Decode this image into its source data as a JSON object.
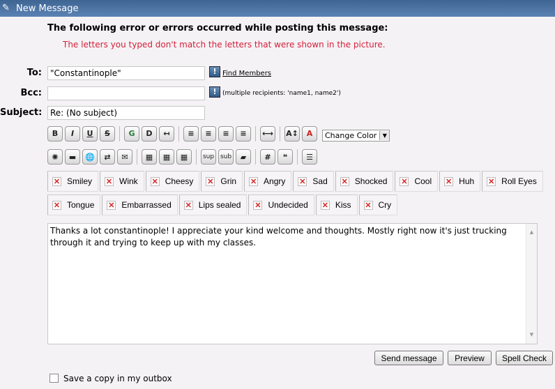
{
  "window": {
    "title": "New Message"
  },
  "error": {
    "heading": "The following error or errors occurred while posting this message:",
    "message": "The letters you typed don't match the letters that were shown in the picture.",
    "color": "#d4203a"
  },
  "form": {
    "to_label": "To:",
    "to_value": "\"Constantinople\"",
    "find_members": "Find Members",
    "bcc_label": "Bcc:",
    "bcc_value": "",
    "bcc_hint": "(multiple recipients: 'name1, name2')",
    "subject_label": "Subject:",
    "subject_value": "Re: (No subject)"
  },
  "toolbar": {
    "row1": [
      [
        "bold",
        "B"
      ],
      [
        "italic",
        "I"
      ],
      [
        "underline",
        "U"
      ],
      [
        "strikethrough",
        "S"
      ],
      "|",
      [
        "glow",
        "G"
      ],
      [
        "shadow",
        "D"
      ],
      [
        "move",
        "↤"
      ],
      "|",
      [
        "preformatted",
        "≡"
      ],
      [
        "align-left",
        "≡"
      ],
      [
        "align-center",
        "≡"
      ],
      [
        "align-right",
        "≡"
      ],
      "|",
      [
        "horizontal-rule",
        "⟷"
      ],
      "|",
      [
        "font-size",
        "A↕"
      ],
      [
        "font-face",
        "A"
      ]
    ],
    "row2": [
      [
        "flash",
        "✺"
      ],
      [
        "image",
        "▬"
      ],
      [
        "hyperlink",
        "🌐"
      ],
      [
        "ftp",
        "⇄"
      ],
      [
        "email",
        "✉"
      ],
      "|",
      [
        "table",
        "▦"
      ],
      [
        "table-row",
        "▦"
      ],
      [
        "table-column",
        "▦"
      ],
      "|",
      [
        "superscript",
        "sup"
      ],
      [
        "subscript",
        "sub"
      ],
      [
        "teletype",
        "▰"
      ],
      "|",
      [
        "code",
        "#"
      ],
      [
        "quote",
        "❝"
      ],
      "|",
      [
        "list",
        "☰"
      ]
    ],
    "change_color": "Change Color"
  },
  "smileys": {
    "row1": [
      "Smiley",
      "Wink",
      "Cheesy",
      "Grin",
      "Angry",
      "Sad",
      "Shocked",
      "Cool",
      "Huh",
      "Roll Eyes"
    ],
    "row2": [
      "Tongue",
      "Embarrassed",
      "Lips sealed",
      "Undecided",
      "Kiss",
      "Cry"
    ]
  },
  "message": {
    "body": "Thanks a lot constantinople! I appreciate your kind welcome and thoughts. Mostly right now it's just trucking through it and trying to keep up with my classes."
  },
  "buttons": {
    "send": "Send message",
    "preview": "Preview",
    "spell": "Spell Check"
  },
  "save_copy": {
    "label": "Save a copy in my outbox",
    "checked": false
  }
}
